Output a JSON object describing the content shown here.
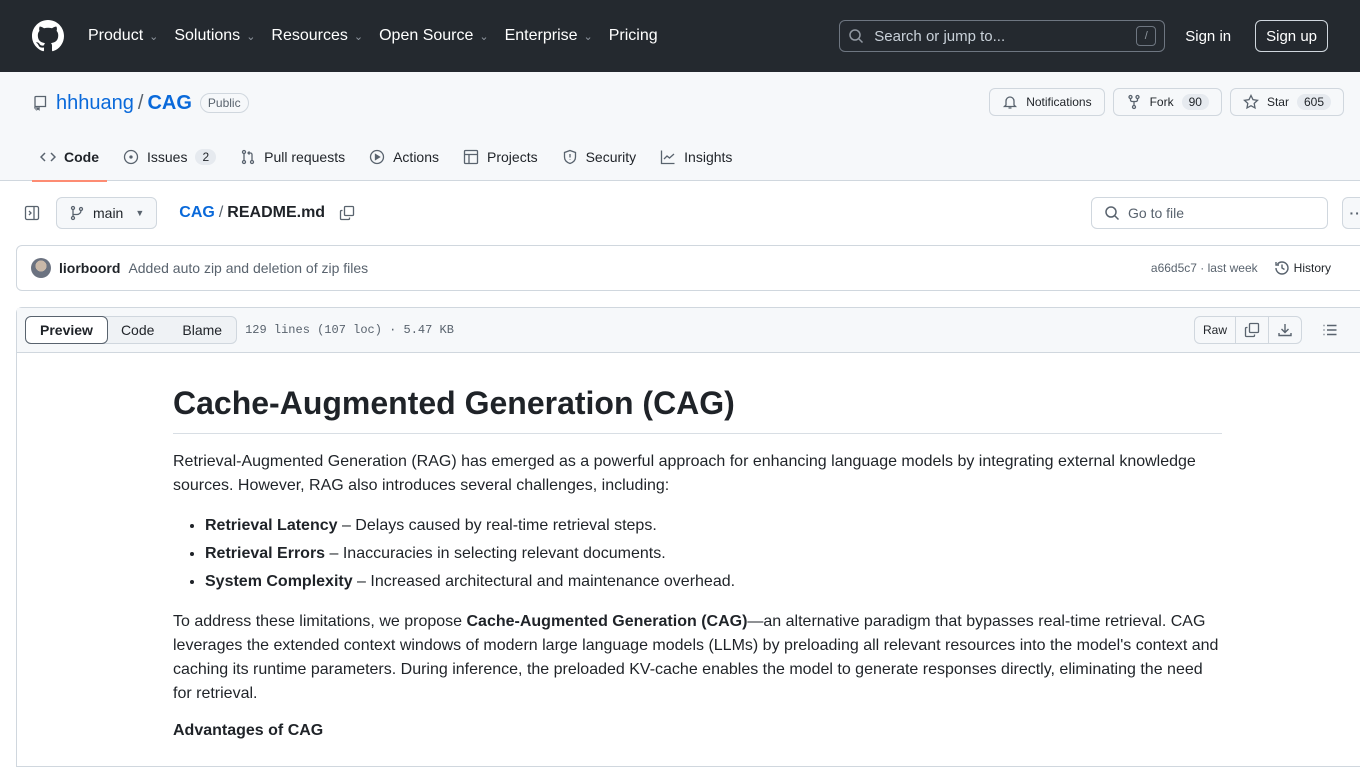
{
  "header": {
    "nav": [
      {
        "label": "Product",
        "chevron": true
      },
      {
        "label": "Solutions",
        "chevron": true
      },
      {
        "label": "Resources",
        "chevron": true
      },
      {
        "label": "Open Source",
        "chevron": true
      },
      {
        "label": "Enterprise",
        "chevron": true
      },
      {
        "label": "Pricing",
        "chevron": false
      }
    ],
    "search_placeholder": "Search or jump to...",
    "search_shortcut": "/",
    "signin": "Sign in",
    "signup": "Sign up"
  },
  "repo": {
    "owner": "hhhuang",
    "sep": "/",
    "name": "CAG",
    "visibility": "Public",
    "notifications": "Notifications",
    "fork_label": "Fork",
    "fork_count": "90",
    "star_label": "Star",
    "star_count": "605"
  },
  "tabs": [
    {
      "label": "Code",
      "icon": "code-icon",
      "active": true
    },
    {
      "label": "Issues",
      "icon": "issue-icon",
      "count": "2"
    },
    {
      "label": "Pull requests",
      "icon": "pull-request-icon"
    },
    {
      "label": "Actions",
      "icon": "play-icon"
    },
    {
      "label": "Projects",
      "icon": "table-icon"
    },
    {
      "label": "Security",
      "icon": "shield-icon"
    },
    {
      "label": "Insights",
      "icon": "graph-icon"
    }
  ],
  "filebar": {
    "branch": "main",
    "crumb_repo": "CAG",
    "crumb_sep": "/",
    "crumb_file": "README.md",
    "goto_placeholder": "Go to file"
  },
  "commit": {
    "author": "liorboord",
    "message": "Added auto zip and deletion of zip files",
    "hash": "a66d5c7",
    "sep": " · ",
    "time": "last week",
    "history": "History"
  },
  "filehead": {
    "views": [
      "Preview",
      "Code",
      "Blame"
    ],
    "active": "Preview",
    "info": "129 lines (107 loc) · 5.47 KB",
    "raw": "Raw"
  },
  "readme": {
    "title": "Cache-Augmented Generation (CAG)",
    "intro": "Retrieval-Augmented Generation (RAG) has emerged as a powerful approach for enhancing language models by integrating external knowledge sources. However, RAG also introduces several challenges, including:",
    "bullets": [
      {
        "bold": "Retrieval Latency",
        "text": " – Delays caused by real-time retrieval steps."
      },
      {
        "bold": "Retrieval Errors",
        "text": " – Inaccuracies in selecting relevant documents."
      },
      {
        "bold": "System Complexity",
        "text": " – Increased architectural and maintenance overhead."
      }
    ],
    "p2_pre": "To address these limitations, we propose ",
    "p2_bold": "Cache-Augmented Generation (CAG)",
    "p2_post": "—an alternative paradigm that bypasses real-time retrieval. CAG leverages the extended context windows of modern large language models (LLMs) by preloading all relevant resources into the model's context and caching its runtime parameters. During inference, the preloaded KV-cache enables the model to generate responses directly, eliminating the need for retrieval.",
    "h3": "Advantages of CAG"
  }
}
